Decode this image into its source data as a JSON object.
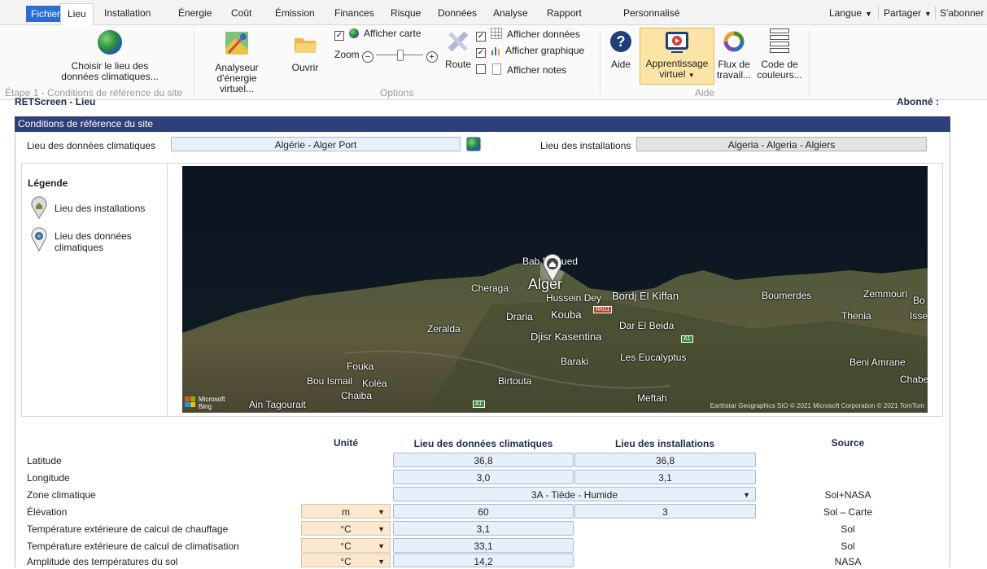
{
  "tabs": {
    "file": "Fichier",
    "items": [
      "Lieu",
      "Installation",
      "Énergie",
      "Coût",
      "Émission",
      "Finances",
      "Risque",
      "Données",
      "Analyse",
      "Rapport",
      "Personnalisé"
    ],
    "active": "Lieu"
  },
  "topright": {
    "language": "Langue",
    "share": "Partager",
    "subscribe": "S'abonner"
  },
  "ribbon": {
    "choose_location_line1": "Choisir le lieu des",
    "choose_location_line2": "données climatiques...",
    "analyzer_line1": "Analyseur",
    "analyzer_line2": "d'énergie virtuel...",
    "open": "Ouvrir",
    "step_label": "Étape 1 - Conditions de référence du site",
    "show_map": "Afficher carte",
    "zoom": "Zoom",
    "options_label": "Options",
    "route": "Route",
    "show_data": "Afficher données",
    "show_chart": "Afficher graphique",
    "show_notes": "Afficher notes",
    "help": "Aide",
    "virtual_learning_line1": "Apprentissage",
    "virtual_learning_line2": "virtuel",
    "workflow_line1": "Flux de",
    "workflow_line2": "travail...",
    "color_code_line1": "Code de",
    "color_code_line2": "couleurs...",
    "help_group_label": "Aide"
  },
  "header": {
    "left": "RETScreen - Lieu",
    "right": "Abonné :"
  },
  "section": {
    "title": "Conditions de référence du site",
    "climate_label": "Lieu des données climatiques",
    "climate_value": "Algérie - Alger Port",
    "facility_label": "Lieu des installations",
    "facility_value": "Algeria - Algeria - Algiers"
  },
  "legend": {
    "title": "Légende",
    "item1": "Lieu des installations",
    "item2_line1": "Lieu des données",
    "item2_line2": "climatiques"
  },
  "map": {
    "labels": [
      "Bab El Oued",
      "Alger",
      "Cheraga",
      "Hussein Dey",
      "Bordj El Kiffan",
      "Boumerdes",
      "Zemmouri",
      "Thenia",
      "Isser",
      "Draria",
      "Kouba",
      "Dar El Beida",
      "Zeralda",
      "Djisr Kasentina",
      "Baraki",
      "Les Eucalyptus",
      "Beni Amrane",
      "Chabet",
      "Fouka",
      "Bou Ismail",
      "Koléa",
      "Birtouta",
      "Chaiba",
      "Ain Tagourait",
      "Meftah",
      "Bo"
    ],
    "road_badges": [
      "RN11",
      "A1",
      "A1"
    ],
    "brand_line1": "Microsoft",
    "brand_line2": "Bing",
    "copyright": "Earthstar Geographics SIO © 2021 Microsoft Corporation © 2021 TomTom"
  },
  "table": {
    "col_unit": "Unité",
    "col_climate": "Lieu des données climatiques",
    "col_facility": "Lieu des installations",
    "col_source": "Source",
    "rows": [
      {
        "label": "Latitude",
        "unit": "",
        "climate": "36,8",
        "facility": "36,8",
        "source": ""
      },
      {
        "label": "Longitude",
        "unit": "",
        "climate": "3,0",
        "facility": "3,1",
        "source": ""
      },
      {
        "label": "Zone climatique",
        "unit": "",
        "climate": "3A - Tiède - Humide",
        "facility": "",
        "source": "Sol+NASA"
      },
      {
        "label": "Élévation",
        "unit": "m",
        "climate": "60",
        "facility": "3",
        "source": "Sol – Carte"
      },
      {
        "label": "Température extérieure de calcul de chauffage",
        "unit": "°C",
        "climate": "3,1",
        "facility": "",
        "source": "Sol"
      },
      {
        "label": "Température extérieure de calcul de climatisation",
        "unit": "°C",
        "climate": "33,1",
        "facility": "",
        "source": "Sol"
      },
      {
        "label": "Amplitude des températures du sol",
        "unit": "°C",
        "climate": "14,2",
        "facility": "",
        "source": "NASA"
      }
    ]
  },
  "colors": {
    "file_tab": "#2b6bd3",
    "section_bar": "#2f3f77",
    "field_bg": "#e6f0fb",
    "unit_bg": "#fbe8cf",
    "virtual_learning_bg": "#fce3a6"
  }
}
